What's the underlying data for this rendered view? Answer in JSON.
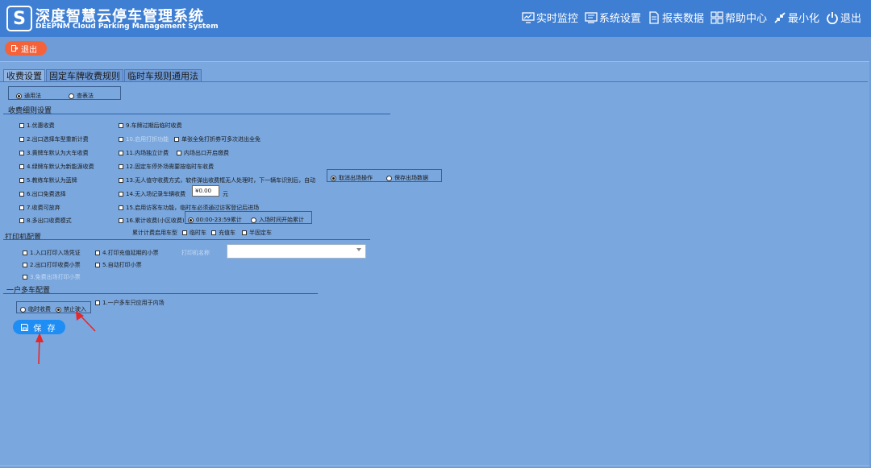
{
  "header": {
    "logo_glyph": "S",
    "title_cn": "深度智慧云停车管理系统",
    "title_en": "DEEPNM Cloud Parking Management System",
    "nav": [
      {
        "label": "实时监控",
        "icon": "monitor-icon"
      },
      {
        "label": "系统设置",
        "icon": "settings-screen-icon"
      },
      {
        "label": "报表数据",
        "icon": "report-icon"
      },
      {
        "label": "帮助中心",
        "icon": "grid-icon"
      },
      {
        "label": "最小化",
        "icon": "minimize-icon"
      },
      {
        "label": "退出",
        "icon": "power-icon"
      }
    ]
  },
  "exit_button": {
    "label": "退出"
  },
  "tabs": [
    "收费设置",
    "固定车牌收费规则",
    "临时车规则通用法"
  ],
  "mode": {
    "options": [
      "通用法",
      "查表法"
    ],
    "selected": "通用法"
  },
  "fee_detail": {
    "title": "收费细则设置",
    "left": [
      "1.优惠收费",
      "2.出口选择车型重新计费",
      "3.黄牌车默认为大车收费",
      "4.绿牌车默认为新能源收费",
      "5.教练车默认为蓝牌",
      "6.出口免费选择",
      "7.收费可放弃",
      "8.多出口收费模式"
    ],
    "r9": "9.车牌过期后临时收费",
    "r10": "10.启用打折功能",
    "r10b": "单张全免打折券可多次进出全免",
    "r11": "11.内场独立计费",
    "r11b": "内场出口开启缴费",
    "r12": "12.固定车停外场需要按临时车收费",
    "r13": "13.无人值守收费方式，软件弹出收费框无人处理时，下一辆车识别后，自动",
    "r13_options": [
      "取消出场操作",
      "保存出场数据"
    ],
    "r14": "14.无入场记录车辆收费",
    "r14_value": "¥0.00",
    "r14_unit": "元",
    "r15": "15.启用访客车功能，临时车必须通过访客登记后进场",
    "r16": "16.累计收费(小区收费)",
    "r16_options": [
      "00:00-23:59累计",
      "入场时间开始累计"
    ],
    "r16_selected": "00:00-23:59累计",
    "types_label": "累计计费启用车型",
    "types": [
      "临时车",
      "充值车",
      "半固定车"
    ]
  },
  "printer": {
    "title": "打印机配置",
    "items": [
      "1.入口打印入场凭证",
      "2.出口打印收费小票",
      "3.免费出场打印小票"
    ],
    "items_right": [
      "4.打印充值延期的小票",
      "5.自动打印小票"
    ],
    "printer_name_label": "打印机名称"
  },
  "multi_car": {
    "title": "一户多车配置",
    "options": [
      "临时收费",
      "禁止驶入"
    ],
    "selected": "禁止驶入",
    "item": "1.一户多车只应用于内场"
  },
  "save_button": {
    "label": "保 存"
  },
  "colors": {
    "header": "#3f7fd3",
    "exit": "#f4623a",
    "save": "#1e8ef5",
    "arrow": "#e8272a"
  }
}
